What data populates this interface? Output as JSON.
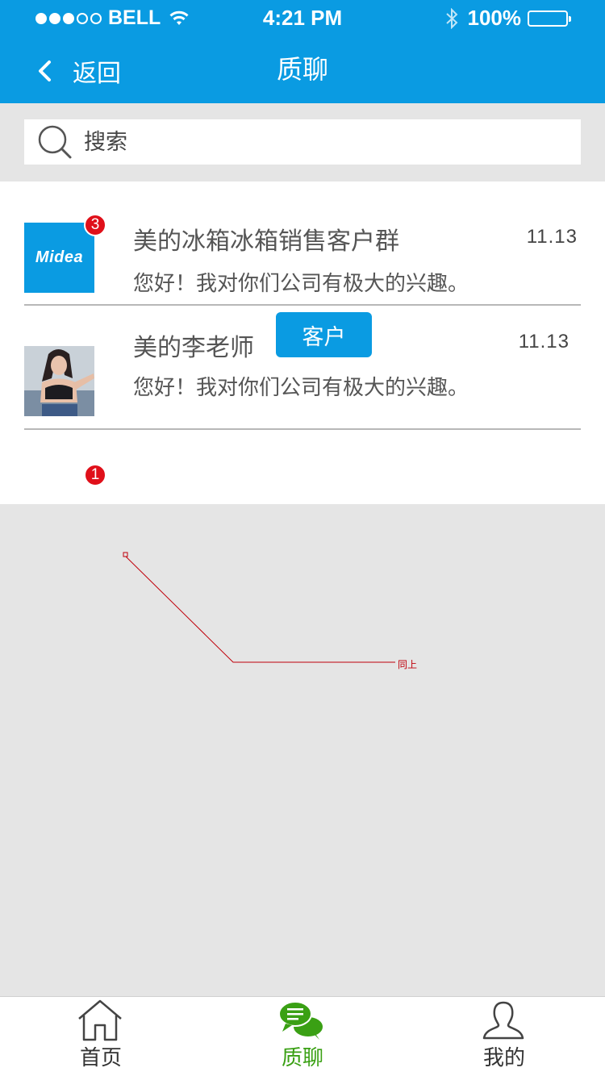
{
  "status_bar": {
    "carrier": "BELL",
    "time": "4:21 PM",
    "battery": "100%"
  },
  "header": {
    "back_label": "返回",
    "title": "质聊"
  },
  "search": {
    "placeholder": "搜索"
  },
  "conversations": [
    {
      "name": "美的冰箱冰箱销售客户群",
      "message": "您好！我对你们公司有极大的兴趣。",
      "time": "11.13",
      "badge": "3",
      "avatar_logo": "Midea",
      "avatar_icon": "midea-logo-avatar"
    },
    {
      "name": "美的李老师",
      "tag": "客户",
      "message": "您好！我对你们公司有极大的兴趣。",
      "time": "11.13",
      "badge": "1",
      "avatar_icon": "user-photo-avatar"
    }
  ],
  "annotation": {
    "text": "同上",
    "color": "#c0000a"
  },
  "tabbar": {
    "items": [
      {
        "label": "首页",
        "icon": "home-icon"
      },
      {
        "label": "质聊",
        "icon": "chat-bubbles-icon",
        "active": true
      },
      {
        "label": "我的",
        "icon": "user-icon"
      }
    ]
  },
  "colors": {
    "brand": "#0a9be2",
    "badge": "#e0101a",
    "active_tab": "#3aa014"
  }
}
